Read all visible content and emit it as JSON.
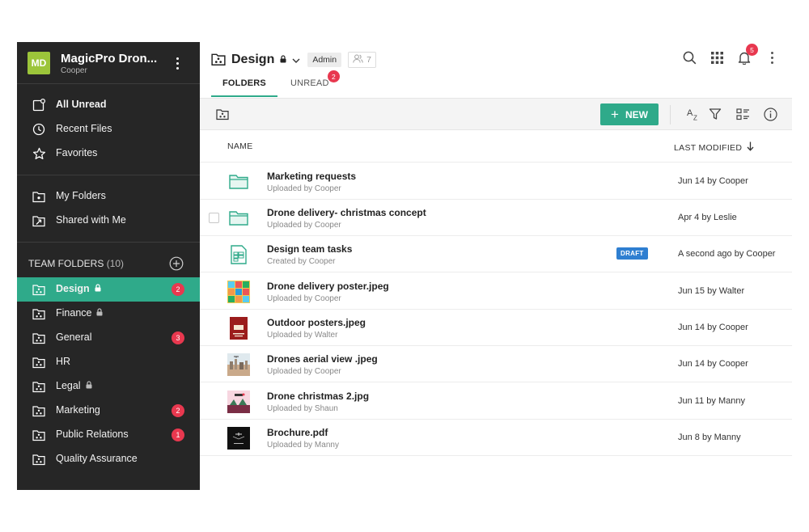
{
  "workspace": {
    "initials": "MD",
    "name": "MagicPro Dron...",
    "user": "Cooper"
  },
  "nav": {
    "primary": [
      {
        "label": "All Unread",
        "icon": "unread-icon"
      },
      {
        "label": "Recent Files",
        "icon": "clock-icon"
      },
      {
        "label": "Favorites",
        "icon": "star-icon"
      }
    ],
    "secondary": [
      {
        "label": "My Folders",
        "icon": "folder-icon"
      },
      {
        "label": "Shared with Me",
        "icon": "shared-folder-icon"
      }
    ]
  },
  "team": {
    "title": "TEAM FOLDERS",
    "count": "(10)",
    "folders": [
      {
        "label": "Design",
        "locked": true,
        "badge": "2",
        "active": true
      },
      {
        "label": "Finance",
        "locked": true,
        "badge": ""
      },
      {
        "label": "General",
        "locked": false,
        "badge": "3"
      },
      {
        "label": "HR",
        "locked": false,
        "badge": ""
      },
      {
        "label": "Legal",
        "locked": true,
        "badge": ""
      },
      {
        "label": "Marketing",
        "locked": false,
        "badge": "2"
      },
      {
        "label": "Public Relations",
        "locked": false,
        "badge": "1"
      },
      {
        "label": "Quality Assurance",
        "locked": false,
        "badge": ""
      }
    ]
  },
  "header": {
    "title": "Design",
    "role": "Admin",
    "members": "7",
    "notifications": "5"
  },
  "tabs": [
    {
      "label": "FOLDERS",
      "active": true,
      "badge": ""
    },
    {
      "label": "UNREAD",
      "active": false,
      "badge": "2"
    }
  ],
  "toolbar": {
    "new_label": "NEW"
  },
  "columns": {
    "name": "NAME",
    "modified": "LAST MODIFIED"
  },
  "files": [
    {
      "name": "Marketing requests",
      "sub": "Uploaded by Cooper",
      "modified": "Jun 14 by Cooper",
      "type": "folder",
      "draft": ""
    },
    {
      "name": "Drone delivery- christmas concept",
      "sub": "Uploaded by Cooper",
      "modified": "Apr 4 by Leslie",
      "type": "folder",
      "draft": ""
    },
    {
      "name": "Design team tasks",
      "sub": "Created by Cooper",
      "modified": "A second ago by Cooper",
      "type": "sheet",
      "draft": "DRAFT"
    },
    {
      "name": "Drone delivery poster.jpeg",
      "sub": "Uploaded by Cooper",
      "modified": "Jun 15 by Walter",
      "type": "image-grid",
      "draft": ""
    },
    {
      "name": "Outdoor posters.jpeg",
      "sub": "Uploaded by Walter",
      "modified": "Jun 14 by Cooper",
      "type": "image-red",
      "draft": ""
    },
    {
      "name": "Drones aerial view .jpeg",
      "sub": "Uploaded by Cooper",
      "modified": "Jun 14 by Cooper",
      "type": "image-city",
      "draft": ""
    },
    {
      "name": "Drone christmas 2.jpg",
      "sub": "Uploaded by Shaun",
      "modified": "Jun 11 by Manny",
      "type": "image-xmas",
      "draft": ""
    },
    {
      "name": "Brochure.pdf",
      "sub": "Uploaded by Manny",
      "modified": "Jun 8 by Manny",
      "type": "pdf-dark",
      "draft": ""
    }
  ],
  "colors": {
    "accent": "#2faa8a",
    "badge": "#e8384f",
    "sidebar": "#262626",
    "draft": "#2f7fd1",
    "avatar": "#9cc53a"
  }
}
